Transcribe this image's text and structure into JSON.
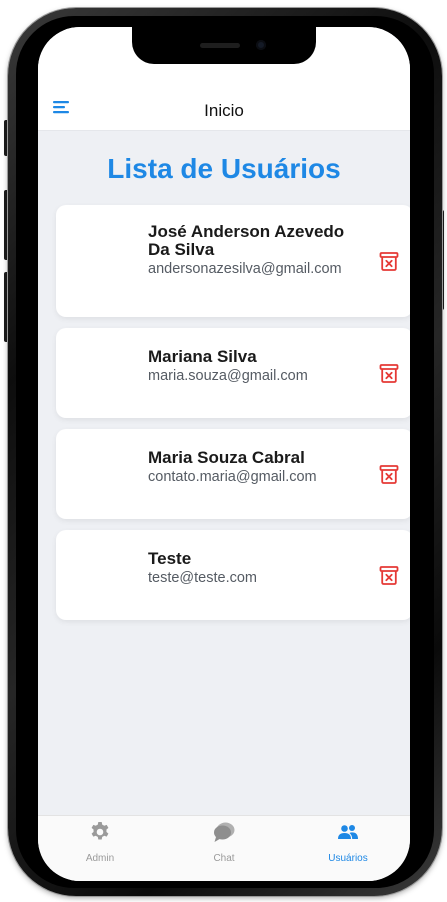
{
  "header": {
    "title": "Inicio",
    "menu_icon": "hamburger-menu-icon"
  },
  "page": {
    "title": "Lista de Usuários"
  },
  "users": [
    {
      "name": "José Anderson Azevedo Da Silva",
      "email": "andersonazesilva@gmail.com"
    },
    {
      "name": "Mariana Silva",
      "email": "maria.souza@gmail.com"
    },
    {
      "name": "Maria Souza Cabral",
      "email": "contato.maria@gmail.com"
    },
    {
      "name": "Teste",
      "email": "teste@teste.com"
    }
  ],
  "delete_icon": "trash-delete-icon",
  "tabs": [
    {
      "label": "Admin",
      "icon": "gear-icon",
      "active": false
    },
    {
      "label": "Chat",
      "icon": "chat-bubble-icon",
      "active": false
    },
    {
      "label": "Usuários",
      "icon": "users-icon",
      "active": true
    }
  ],
  "colors": {
    "accent": "#1e88e5",
    "delete": "#e53935",
    "inactive": "#9a9a9a",
    "background": "#eef0f4"
  }
}
